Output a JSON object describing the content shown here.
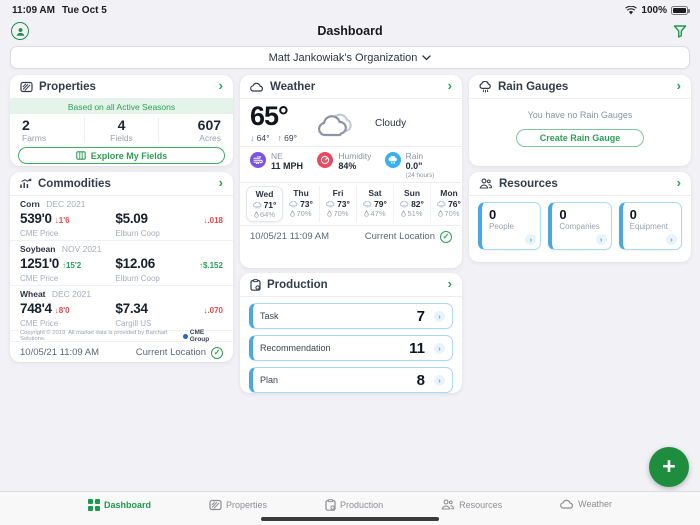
{
  "status_bar": {
    "time": "11:09 AM",
    "date": "Tue Oct 5",
    "battery": "100%"
  },
  "header": {
    "title": "Dashboard"
  },
  "org_selector": {
    "label": "Matt Jankowiak's Organization"
  },
  "properties": {
    "title": "Properties",
    "banner": "Based on all Active Seasons",
    "stats": [
      {
        "value": "2",
        "label": "Farms"
      },
      {
        "value": "4",
        "label": "Fields"
      },
      {
        "value": "607",
        "label": "Acres"
      }
    ],
    "button": "Explore My Fields"
  },
  "commodities": {
    "title": "Commodities",
    "items": [
      {
        "name": "Corn",
        "contract": "DEC 2021",
        "price": "539'0",
        "change": "1'6",
        "direction": "down",
        "exchange": "CME Price",
        "local_price": "$5.09",
        "local_source": "Elburn Coop",
        "local_change": ".018",
        "local_direction": "down"
      },
      {
        "name": "Soybean",
        "contract": "NOV 2021",
        "price": "1251'0",
        "change": "15'2",
        "direction": "up",
        "exchange": "CME Price",
        "local_price": "$12.06",
        "local_source": "Elburn Coop",
        "local_change": "$.152",
        "local_direction": "up"
      },
      {
        "name": "Wheat",
        "contract": "DEC 2021",
        "price": "748'4",
        "change": "8'0",
        "direction": "down",
        "exchange": "CME Price",
        "local_price": "$7.34",
        "local_source": "Cargill US",
        "local_change": ".070",
        "local_direction": "down"
      }
    ],
    "copyright": "Copyright © 2019. All market data is provided by Barchart Solutions.",
    "attribution": "CME Group",
    "timestamp": "10/05/21 11:09 AM",
    "location": "Current Location"
  },
  "weather": {
    "title": "Weather",
    "temp": "65°",
    "low": "64°",
    "high": "69°",
    "condition": "Cloudy",
    "wind": {
      "label": "NE",
      "value": "11 MPH"
    },
    "humidity": {
      "label": "Humidity",
      "value": "84%"
    },
    "rain": {
      "label": "Rain",
      "value": "0.0\"",
      "period": "(24 hours)"
    },
    "forecast": [
      {
        "day": "Wed",
        "temp": "71°",
        "precip": "64%"
      },
      {
        "day": "Thu",
        "temp": "73°",
        "precip": "70%"
      },
      {
        "day": "Fri",
        "temp": "73°",
        "precip": "70%"
      },
      {
        "day": "Sat",
        "temp": "79°",
        "precip": "47%"
      },
      {
        "day": "Sun",
        "temp": "82°",
        "precip": "51%"
      },
      {
        "day": "Mon",
        "temp": "76°",
        "precip": "70%"
      }
    ],
    "timestamp": "10/05/21 11:09 AM",
    "location": "Current Location"
  },
  "rain_gauges": {
    "title": "Rain Gauges",
    "empty_message": "You have no Rain Gauges",
    "button": "Create Rain Gauge"
  },
  "resources": {
    "title": "Resources",
    "items": [
      {
        "value": "0",
        "label": "People"
      },
      {
        "value": "0",
        "label": "Companies"
      },
      {
        "value": "0",
        "label": "Equipment"
      }
    ]
  },
  "production": {
    "title": "Production",
    "items": [
      {
        "label": "Task",
        "count": "7"
      },
      {
        "label": "Recommendation",
        "count": "11"
      },
      {
        "label": "Plan",
        "count": "8"
      }
    ]
  },
  "bottom_nav": {
    "items": [
      {
        "label": "Dashboard",
        "active": true
      },
      {
        "label": "Properties",
        "active": false
      },
      {
        "label": "Production",
        "active": false
      },
      {
        "label": "Resources",
        "active": false
      },
      {
        "label": "Weather",
        "active": false
      }
    ]
  },
  "fab": {
    "label": "+"
  },
  "colors": {
    "accent_green": "#1e8e3e",
    "accent_blue": "#47a9e4",
    "down_red": "#e5484d",
    "up_green": "#23a05a",
    "wind_purple": "#7e52e0",
    "humidity_red": "#e84a5f",
    "rain_blue": "#35b1ef"
  }
}
